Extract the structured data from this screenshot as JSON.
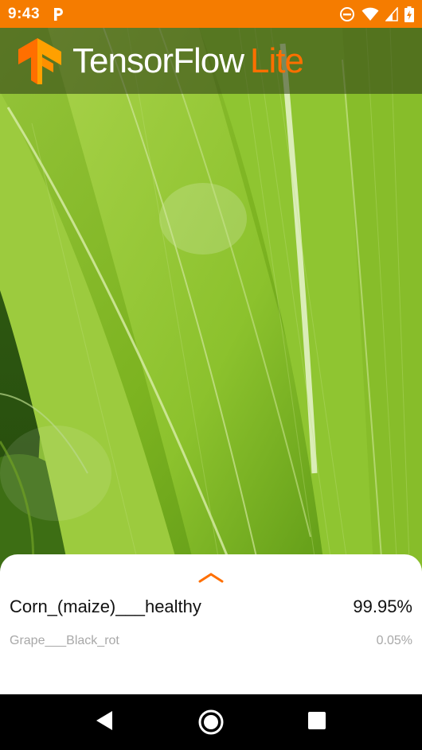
{
  "status_bar": {
    "time": "9:43",
    "icons": [
      "parking-notification-icon",
      "do-not-disturb-icon",
      "wifi-icon",
      "cell-signal-icon",
      "battery-charging-icon"
    ]
  },
  "toolbar": {
    "logo_icon": "tensorflow-logo-icon",
    "brand_main": "TensorFlow",
    "brand_accent": "Lite"
  },
  "colors": {
    "accent": "#ff6f00",
    "status_bar": "#f57c00"
  },
  "bottom_sheet": {
    "expand_icon": "chevron-up-icon",
    "results": [
      {
        "label": "Corn_(maize)___healthy",
        "confidence": "99.95%"
      },
      {
        "label": "Grape___Black_rot",
        "confidence": "0.05%"
      }
    ]
  },
  "nav_bar": {
    "icons": [
      "back-icon",
      "home-icon",
      "recents-icon"
    ]
  }
}
